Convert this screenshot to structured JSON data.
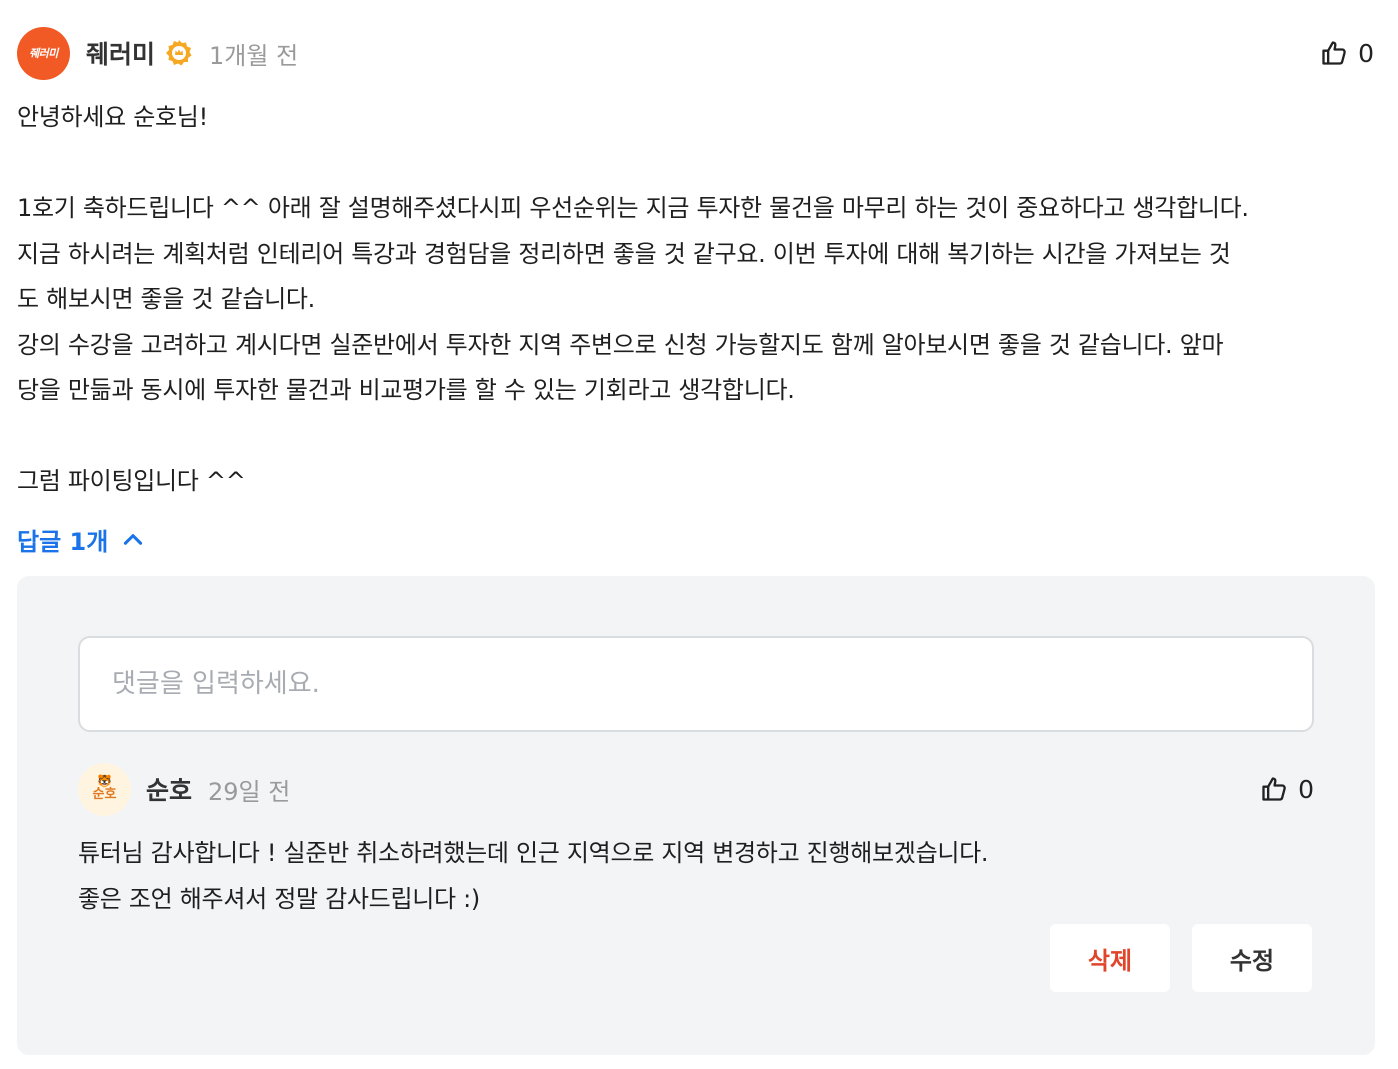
{
  "comment": {
    "avatar_text": "줴러미",
    "author": "줴러미",
    "time": "1개월 전",
    "like_count": "0",
    "paragraphs": [
      "안녕하세요 순호님!",
      "",
      "1호기 축하드립니다 ^^ 아래 잘 설명해주셨다시피 우선순위는 지금 투자한 물건을 마무리 하는 것이 중요하다고 생각합니다.",
      "지금 하시려는 계획처럼 인테리어 특강과 경험담을 정리하면 좋을 것 같구요. 이번 투자에 대해 복기하는 시간을 가져보는 것",
      "도 해보시면 좋을 것 같습니다.",
      "강의 수강을 고려하고 계시다면 실준반에서 투자한 지역 주변으로 신청 가능할지도 함께 알아보시면 좋을 것 같습니다. 앞마",
      "당을 만듦과 동시에 투자한 물건과 비교평가를 할 수 있는 기회라고 생각합니다.",
      "",
      "그럼 파이팅입니다 ^^"
    ]
  },
  "replies_toggle": "답글 1개",
  "reply_input": {
    "placeholder": "댓글을 입력하세요."
  },
  "reply": {
    "avatar_text": "순호",
    "author": "순호",
    "time": "29일 전",
    "like_count": "0",
    "lines": [
      "튜터님 감사합니다 ! 실준반 취소하려했는데 인근 지역으로 지역 변경하고 진행해보겠습니다.",
      "좋은 조언 해주셔서 정말 감사드립니다 :)"
    ],
    "delete_label": "삭제",
    "edit_label": "수정"
  },
  "colors": {
    "brand_orange": "#f15a24",
    "link_blue": "#1a73e8",
    "delete_red": "#e0452b",
    "panel_bg": "#f3f4f6"
  }
}
